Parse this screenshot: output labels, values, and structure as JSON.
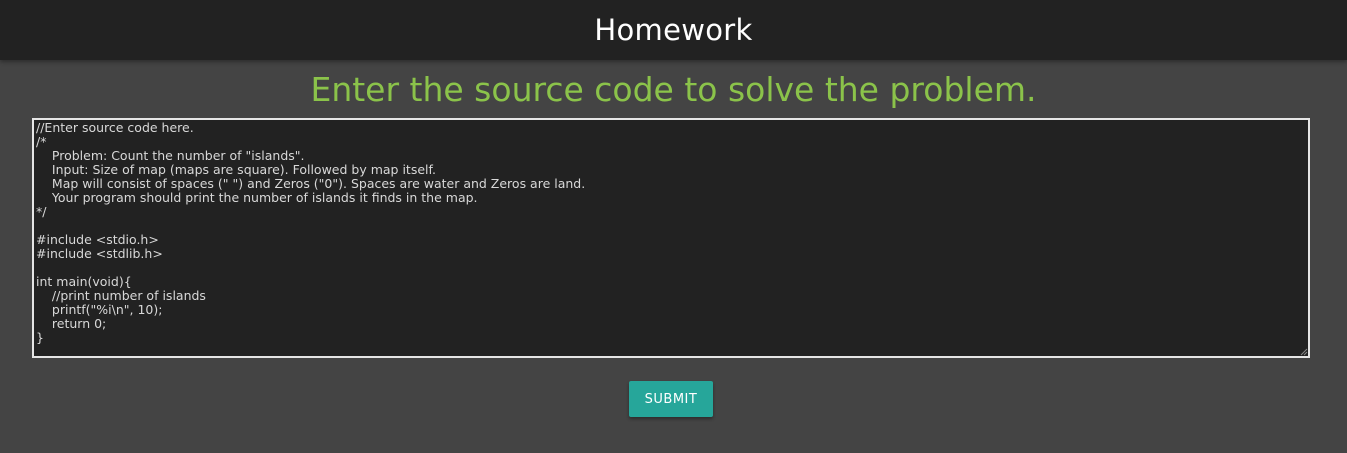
{
  "header": {
    "title": "Homework"
  },
  "instruction": "Enter the source code to solve the problem.",
  "editor": {
    "value": "//Enter source code here.\n/*\n\tProblem: Count the number of \"islands\".\n\tInput: Size of map (maps are square). Followed by map itself.\n\tMap will consist of spaces (\" \") and Zeros (\"0\"). Spaces are water and Zeros are land.\n\tYour program should print the number of islands it finds in the map.\n*/\n\n#include <stdio.h>\n#include <stdlib.h>\n\nint main(void){\n\t//print number of islands\n\tprintf(\"%i\\n\", 10);\n\treturn 0;\n}"
  },
  "submit": {
    "label": "SUBMIT"
  },
  "colors": {
    "header_bg": "#222222",
    "page_bg": "#444444",
    "instruction_text": "#8bc34a",
    "button_bg": "#26a69a"
  }
}
